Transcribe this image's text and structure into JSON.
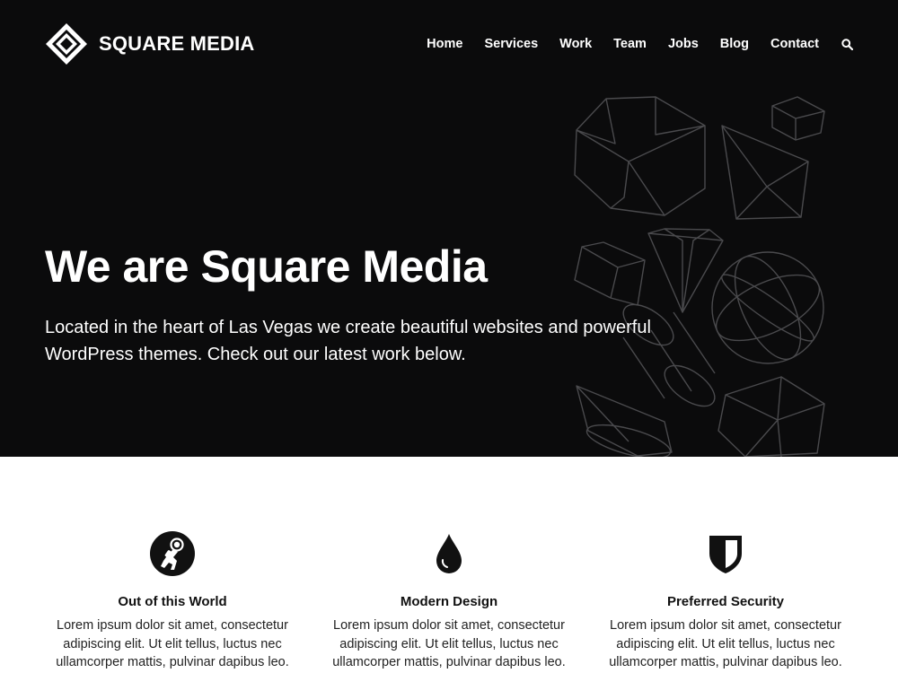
{
  "header": {
    "logo_text": "SQUARE MEDIA",
    "nav": [
      "Home",
      "Services",
      "Work",
      "Team",
      "Jobs",
      "Blog",
      "Contact"
    ]
  },
  "hero": {
    "title": "We are Square Media",
    "subtitle": "Located in the heart of Las Vegas we create beautiful websites and powerful WordPress themes. Check out our latest work below."
  },
  "features": [
    {
      "icon": "astronaut-icon",
      "title": "Out of this World",
      "text": "Lorem ipsum dolor sit amet, consectetur adipiscing elit. Ut elit tellus, luctus nec ullamcorper mattis, pulvinar dapibus leo."
    },
    {
      "icon": "water-drop-icon",
      "title": "Modern Design",
      "text": "Lorem ipsum dolor sit amet, consectetur adipiscing elit. Ut elit tellus, luctus nec ullamcorper mattis, pulvinar dapibus leo."
    },
    {
      "icon": "shield-icon",
      "title": "Preferred Security",
      "text": "Lorem ipsum dolor sit amet, consectetur adipiscing elit. Ut elit tellus, luctus nec ullamcorper mattis, pulvinar dapibus leo."
    }
  ],
  "colors": {
    "hero_background": "#0b0b0c",
    "hero_text": "#ffffff",
    "body_text": "#222222",
    "shape_lines": "#4a4a4d"
  },
  "icons": {
    "logo": "square-diamond-logo-icon",
    "search": "search-icon",
    "decor": "geometric-shapes-illustration"
  }
}
